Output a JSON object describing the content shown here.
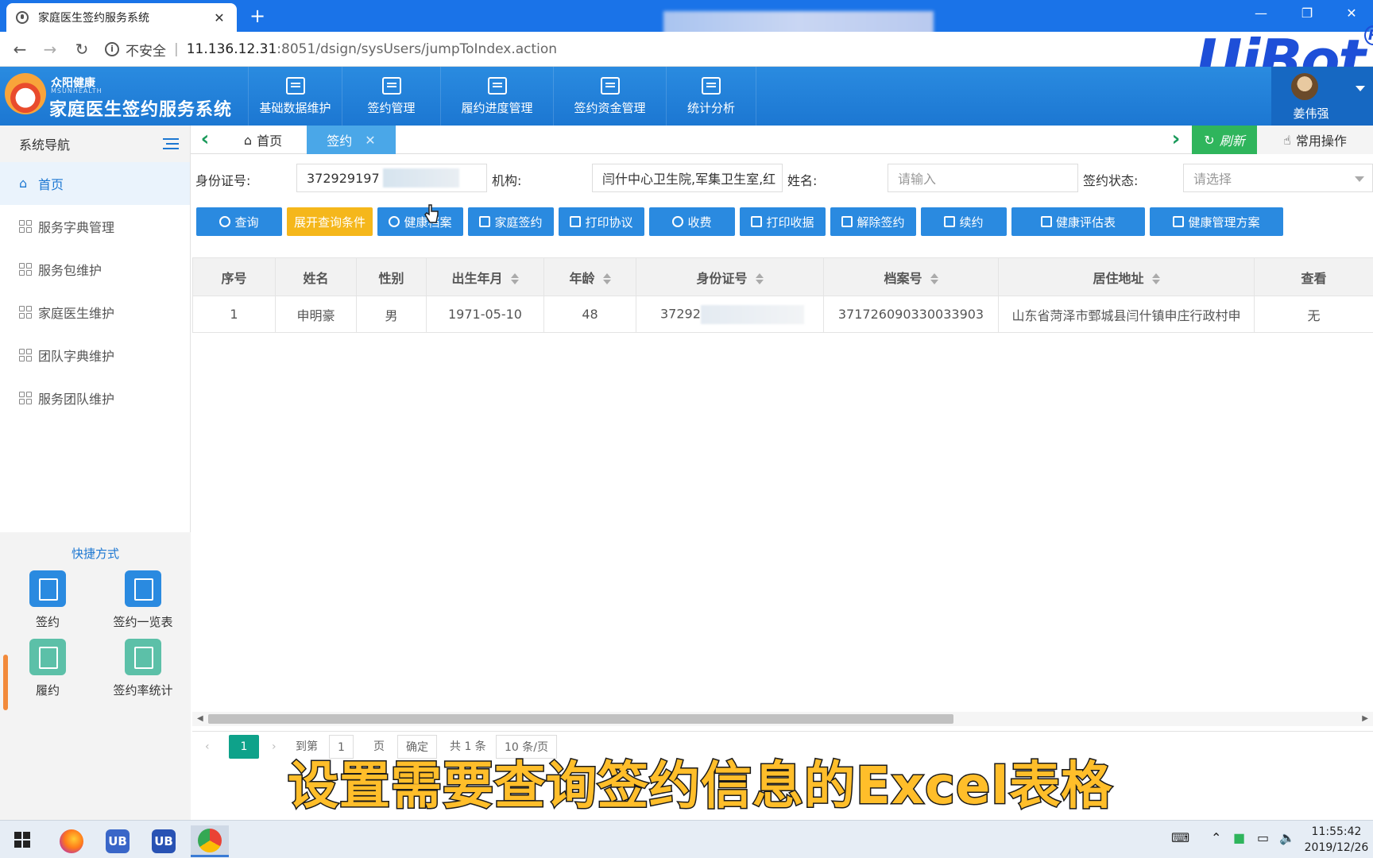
{
  "browser": {
    "tab_title": "家庭医生签约服务系统",
    "tab_close": "✕",
    "new_tab": "+",
    "url_insecure": "不安全",
    "url_host": "11.136.12.31",
    "url_path": ":8051/dsign/sysUsers/jumpToIndex.action",
    "watermark": "UiBot",
    "watermark_mark": "R"
  },
  "app": {
    "logo_cn_small": "众阳健康",
    "logo_en": "MSUNHEALTH",
    "title": "家庭医生签约服务系统",
    "top_menu": [
      "基础数据维护",
      "签约管理",
      "履约进度管理",
      "签约资金管理",
      "统计分析"
    ],
    "user_name": "姜伟强"
  },
  "sidebar": {
    "header": "系统导航",
    "items": [
      "首页",
      "服务字典管理",
      "服务包维护",
      "家庭医生维护",
      "团队字典维护",
      "服务团队维护"
    ],
    "quick_title": "快捷方式",
    "quick": [
      "签约",
      "签约一览表",
      "履约",
      "签约率统计"
    ]
  },
  "tabs": {
    "home": "首页",
    "active": "签约",
    "close": "✕",
    "refresh": "刷新",
    "common_ops": "常用操作"
  },
  "search": {
    "id_label": "身份证号:",
    "id_value": "372929197",
    "org_label": "机构:",
    "org_value": "闫什中心卫生院,军集卫生室,红",
    "name_label": "姓名:",
    "name_placeholder": "请输入",
    "status_label": "签约状态:",
    "status_placeholder": "请选择"
  },
  "buttons": [
    "查询",
    "展开查询条件",
    "健康档案",
    "家庭签约",
    "打印协议",
    "收费",
    "打印收据",
    "解除签约",
    "续约",
    "健康评估表",
    "健康管理方案"
  ],
  "table": {
    "headers": [
      "序号",
      "姓名",
      "性别",
      "出生年月",
      "年龄",
      "身份证号",
      "档案号",
      "居住地址",
      "查看"
    ],
    "rows": [
      [
        "1",
        "申明豪",
        "男",
        "1971-05-10",
        "48",
        "37292",
        "371726090330033903",
        "山东省菏泽市鄄城县闫什镇申庄行政村申",
        "无"
      ]
    ]
  },
  "pager": {
    "current": "1",
    "goto_label": "到第",
    "goto_value": "1",
    "page_label": "页",
    "confirm": "确定",
    "total": "共 1 条",
    "page_size": "10 条/页"
  },
  "subtitle": "设置需要查询签约信息的Excel表格",
  "taskbar": {
    "time": "11:55:42",
    "date": "2019/12/26"
  },
  "colors": {
    "primary": "#2a8ae0",
    "header_blue": "#1c77d2",
    "orange": "#f5b71b",
    "green": "#2fb55c",
    "teal": "#0ea28a"
  }
}
